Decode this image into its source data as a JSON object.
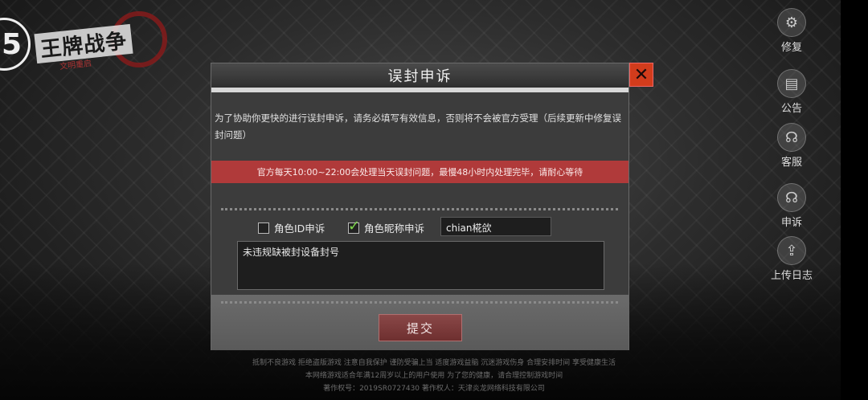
{
  "left_badge": "5",
  "logo": {
    "title": "王牌战争",
    "subtitle": "文明重启"
  },
  "side_menu": [
    {
      "label": "修复",
      "icon": "gear-icon",
      "glyph": "⚙"
    },
    {
      "label": "公告",
      "icon": "notice-icon",
      "glyph": "▤"
    },
    {
      "label": "客服",
      "icon": "headset-icon",
      "glyph": "☊"
    },
    {
      "label": "申诉",
      "icon": "appeal-headset-icon",
      "glyph": "☊"
    },
    {
      "label": "上传日志",
      "icon": "upload-icon",
      "glyph": "⇪"
    }
  ],
  "dialog": {
    "title": "误封申诉",
    "close": "✕",
    "info": "为了协助你更快的进行误封申诉，请务必填写有效信息，否则将不会被官方受理（后续更新中修复误封问题）",
    "notice": "官方每天10:00~22:00会处理当天误封问题，最慢48小时内处理完毕，请耐心等待",
    "option_id": {
      "label": "角色ID申诉",
      "checked": false
    },
    "option_nick": {
      "label": "角色昵称申诉",
      "checked": true
    },
    "name_value": "chian椛欱",
    "reason_value": "未违规缺被封设备封号",
    "submit": "提交"
  },
  "footer": {
    "line1": "抵制不良游戏 拒绝盗版游戏 注意自我保护 谨防受骗上当 适度游戏益脑 沉迷游戏伤身 合理安排时间 享受健康生活",
    "line2": "本网络游戏适合年满12周岁以上的用户使用 为了您的健康，请合理控制游戏时间",
    "line3": "著作权号：2019SR0727430    著作权人：天津炎龙网络科技有限公司"
  }
}
